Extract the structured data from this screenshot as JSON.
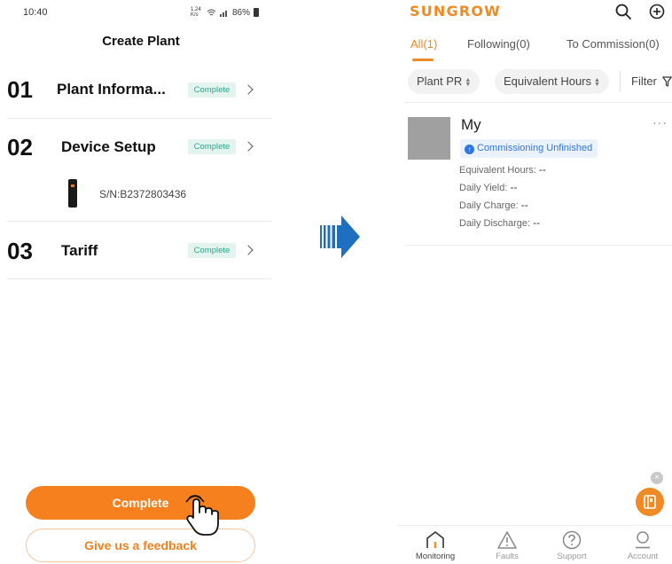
{
  "left_screen": {
    "status_bar": {
      "time": "10:40",
      "speed": "1.24 K/s",
      "battery": "86%"
    },
    "title": "Create Plant",
    "steps": [
      {
        "number": "01",
        "title": "Plant Informa...",
        "status": "Complete"
      },
      {
        "number": "02",
        "title": "Device Setup",
        "status": "Complete"
      },
      {
        "number": "03",
        "title": "Tariff",
        "status": "Complete"
      }
    ],
    "device": {
      "serial": "S/N:B2372803436"
    },
    "buttons": {
      "complete": "Complete",
      "feedback": "Give us a feedback"
    }
  },
  "right_screen": {
    "brand": "SUNGROW",
    "tabs": [
      {
        "label": "All(1)",
        "active": true
      },
      {
        "label": "Following(0)",
        "active": false
      },
      {
        "label": "To Commission(0)",
        "active": false
      }
    ],
    "filters": {
      "sort_1": "Plant PR",
      "sort_2": "Equivalent Hours",
      "filter": "Filter"
    },
    "plant": {
      "name": "My",
      "status": "Commissioning Unfinished",
      "metrics": [
        {
          "label": "Equivalent Hours:",
          "value": "--"
        },
        {
          "label": "Daily Yield:",
          "value": "--"
        },
        {
          "label": "Daily Charge:",
          "value": "--"
        },
        {
          "label": "Daily Discharge:",
          "value": "--"
        }
      ]
    },
    "bottom_nav": [
      {
        "label": "Monitoring",
        "icon": "home-icon",
        "active": true
      },
      {
        "label": "Faults",
        "icon": "warning-icon",
        "active": false
      },
      {
        "label": "Support",
        "icon": "help-icon",
        "active": false
      },
      {
        "label": "Account",
        "icon": "user-icon",
        "active": false
      }
    ]
  },
  "colors": {
    "accent": "#f08a24",
    "complete_badge_text": "#2aa78a",
    "status_blue": "#2e76e0",
    "arrow_blue": "#1f6fc0"
  }
}
